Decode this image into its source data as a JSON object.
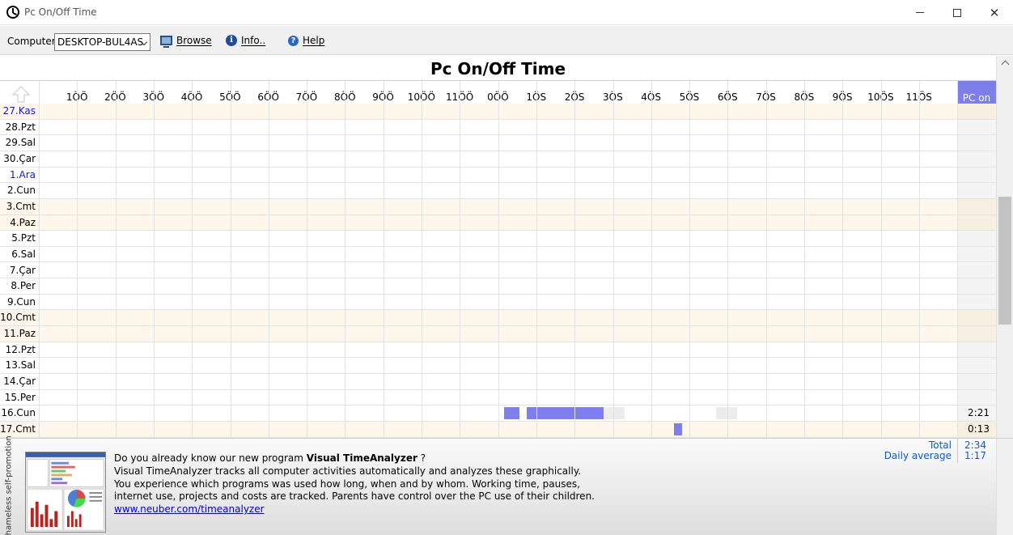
{
  "window": {
    "title": "Pc On/Off Time",
    "minimize": "—",
    "maximize": "☐",
    "close": "✕"
  },
  "toolbar": {
    "computer_label": "Computer",
    "computer_value": "DESKTOP-BUL4AS",
    "browse_label": "Browse",
    "info_label": "Info..",
    "help_label": "Help"
  },
  "chart": {
    "title": "Pc On/Off Time",
    "hours": [
      "1ÖÖ",
      "2ÖÖ",
      "3ÖÖ",
      "4ÖÖ",
      "5ÖÖ",
      "6ÖÖ",
      "7ÖÖ",
      "8ÖÖ",
      "9ÖÖ",
      "10ÖÖ",
      "11ÖÖ",
      "0ÖÖ",
      "1ÖS",
      "2ÖS",
      "3ÖS",
      "4ÖS",
      "5ÖS",
      "6ÖS",
      "7ÖS",
      "8ÖS",
      "9ÖS",
      "10ÖS",
      "11ÖS"
    ],
    "pc_on_header": "PC on",
    "accent_color": "#7e7ef0",
    "rows": [
      {
        "day": "27.Kas",
        "weekend": true,
        "blue": true,
        "pc_on": ""
      },
      {
        "day": "28.Pzt",
        "weekend": false,
        "blue": false,
        "pc_on": ""
      },
      {
        "day": "29.Sal",
        "weekend": false,
        "blue": false,
        "pc_on": ""
      },
      {
        "day": "30.Çar",
        "weekend": false,
        "blue": false,
        "pc_on": ""
      },
      {
        "day": "1.Ara",
        "weekend": false,
        "blue": true,
        "pc_on": ""
      },
      {
        "day": "2.Cun",
        "weekend": false,
        "blue": false,
        "pc_on": ""
      },
      {
        "day": "3.Cmt",
        "weekend": true,
        "blue": false,
        "pc_on": ""
      },
      {
        "day": "4.Paz",
        "weekend": true,
        "blue": false,
        "pc_on": ""
      },
      {
        "day": "5.Pzt",
        "weekend": false,
        "blue": false,
        "pc_on": ""
      },
      {
        "day": "6.Sal",
        "weekend": false,
        "blue": false,
        "pc_on": ""
      },
      {
        "day": "7.Çar",
        "weekend": false,
        "blue": false,
        "pc_on": ""
      },
      {
        "day": "8.Per",
        "weekend": false,
        "blue": false,
        "pc_on": ""
      },
      {
        "day": "9.Cun",
        "weekend": false,
        "blue": false,
        "pc_on": ""
      },
      {
        "day": "10.Cmt",
        "weekend": true,
        "blue": false,
        "pc_on": ""
      },
      {
        "day": "11.Paz",
        "weekend": true,
        "blue": false,
        "pc_on": ""
      },
      {
        "day": "12.Pzt",
        "weekend": false,
        "blue": false,
        "pc_on": ""
      },
      {
        "day": "13.Sal",
        "weekend": false,
        "blue": false,
        "pc_on": ""
      },
      {
        "day": "14.Çar",
        "weekend": false,
        "blue": false,
        "pc_on": ""
      },
      {
        "day": "15.Per",
        "weekend": false,
        "blue": false,
        "pc_on": ""
      },
      {
        "day": "16.Cun",
        "weekend": false,
        "blue": false,
        "pc_on": "2:21",
        "sessions": [
          [
            12.15,
            12.55
          ],
          [
            12.75,
            14.75
          ]
        ],
        "idle": [
          [
            14.75,
            15.3
          ],
          [
            17.7,
            18.25
          ]
        ]
      },
      {
        "day": "17.Cmt",
        "weekend": true,
        "blue": false,
        "pc_on": "0:13",
        "sessions": [
          [
            16.6,
            16.8
          ]
        ],
        "idle": []
      }
    ]
  },
  "totals": {
    "total_label": "Total",
    "total_value": "2:34",
    "average_label": "Daily average",
    "average_value": "1:17"
  },
  "promo": {
    "side_label": "Shameless self-promotion",
    "line1_prefix": "Do you already know our new program ",
    "line1_bold": "Visual TimeAnalyzer",
    "line1_suffix": " ?",
    "line2": "Visual TimeAnalyzer tracks all computer activities automatically and analyzes these graphically.",
    "line3": "You experience which programs was used how long, when and by whom. Working time, pauses,",
    "line4": "internet use, projects and costs are tracked. Parents have control over the PC use of their children.",
    "link": "www.neuber.com/timeanalyzer"
  }
}
